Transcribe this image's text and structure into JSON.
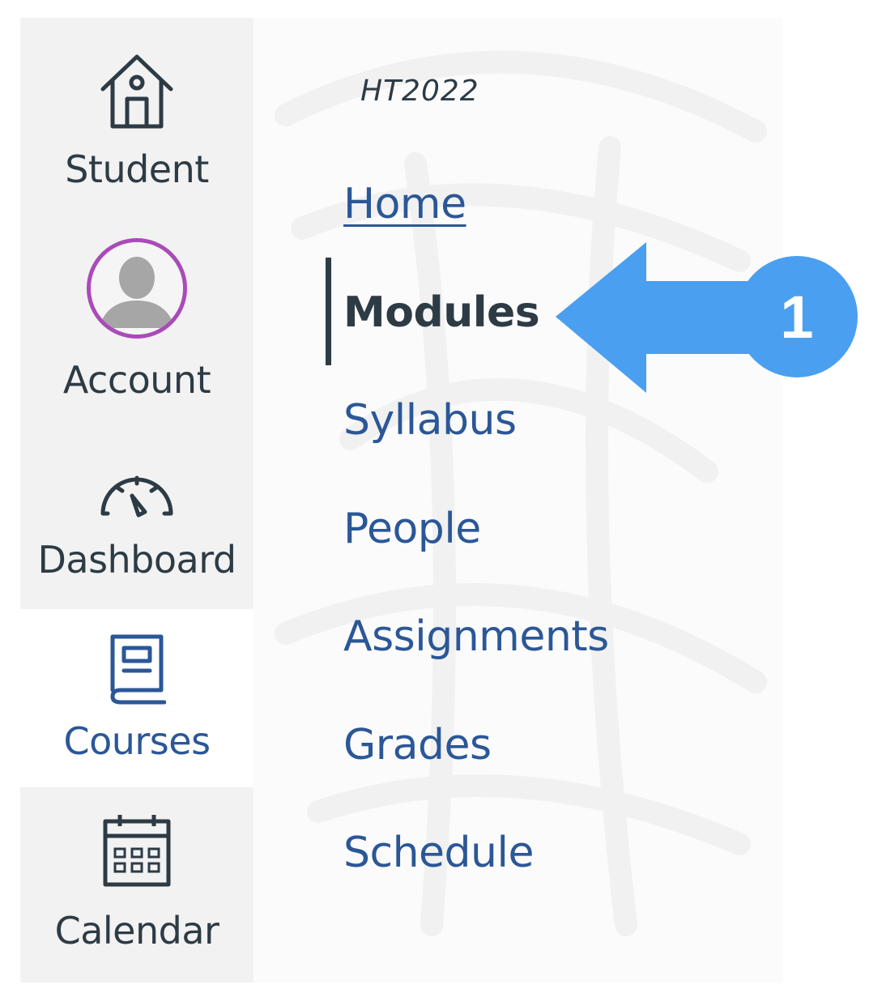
{
  "global_nav": {
    "items": [
      {
        "label": "Student",
        "icon": "house-icon"
      },
      {
        "label": "Account",
        "icon": "avatar"
      },
      {
        "label": "Dashboard",
        "icon": "speedometer-icon"
      },
      {
        "label": "Courses",
        "icon": "book-icon"
      },
      {
        "label": "Calendar",
        "icon": "calendar-icon"
      }
    ],
    "active": "Courses"
  },
  "course_menu": {
    "term": "HT2022",
    "links": [
      "Home",
      "Modules",
      "Syllabus",
      "People",
      "Assignments",
      "Grades",
      "Schedule"
    ],
    "active": "Modules"
  },
  "callout": {
    "number": "1",
    "color": "#4a9ff0"
  },
  "colors": {
    "link": "#2b5797",
    "text": "#2d3b45",
    "nav_bg": "#f2f2f2",
    "avatar_ring": "#a94bb8"
  }
}
